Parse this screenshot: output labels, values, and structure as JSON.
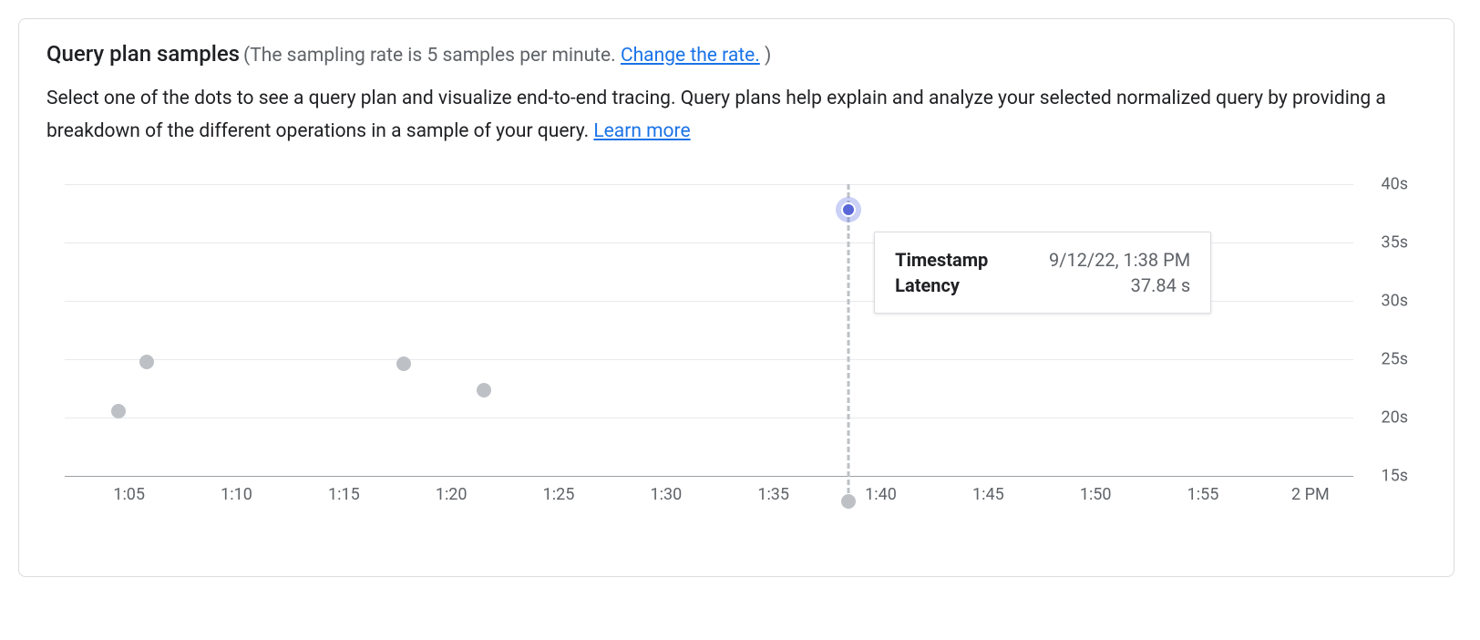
{
  "header": {
    "title": "Query plan samples",
    "paren_prefix": "(",
    "paren_text": "The sampling rate is 5 samples per minute. ",
    "change_link": "Change the rate.",
    "paren_suffix": " )"
  },
  "description": {
    "text": "Select one of the dots to see a query plan and visualize end-to-end tracing. Query plans help explain and analyze your selected normalized query by providing a breakdown of the different operations in a sample of your query. ",
    "learn_more": "Learn more"
  },
  "tooltip": {
    "timestamp_label": "Timestamp",
    "timestamp_value": "9/12/22, 1:38 PM",
    "latency_label": "Latency",
    "latency_value": "37.84 s"
  },
  "chart_data": {
    "type": "scatter",
    "title": "",
    "xlabel": "",
    "ylabel": "",
    "ylim": [
      15,
      40
    ],
    "xlim_minutes": [
      62,
      122
    ],
    "y_ticks": [
      {
        "value": 15,
        "label": "15s"
      },
      {
        "value": 20,
        "label": "20s"
      },
      {
        "value": 25,
        "label": "25s"
      },
      {
        "value": 30,
        "label": "30s"
      },
      {
        "value": 35,
        "label": "35s"
      },
      {
        "value": 40,
        "label": "40s"
      }
    ],
    "x_ticks": [
      {
        "minute": 65,
        "label": "1:05"
      },
      {
        "minute": 70,
        "label": "1:10"
      },
      {
        "minute": 75,
        "label": "1:15"
      },
      {
        "minute": 80,
        "label": "1:20"
      },
      {
        "minute": 85,
        "label": "1:25"
      },
      {
        "minute": 90,
        "label": "1:30"
      },
      {
        "minute": 95,
        "label": "1:35"
      },
      {
        "minute": 100,
        "label": "1:40"
      },
      {
        "minute": 105,
        "label": "1:45"
      },
      {
        "minute": 110,
        "label": "1:50"
      },
      {
        "minute": 115,
        "label": "1:55"
      },
      {
        "minute": 120,
        "label": "2 PM"
      }
    ],
    "points": [
      {
        "x_minute": 64.5,
        "y": 20.6,
        "selected": false
      },
      {
        "x_minute": 65.8,
        "y": 24.8,
        "selected": false
      },
      {
        "x_minute": 77.8,
        "y": 24.6,
        "selected": false
      },
      {
        "x_minute": 81.5,
        "y": 22.4,
        "selected": false
      },
      {
        "x_minute": 98.5,
        "y": 37.84,
        "selected": true
      }
    ],
    "crosshair_x_minute": 98.5
  }
}
